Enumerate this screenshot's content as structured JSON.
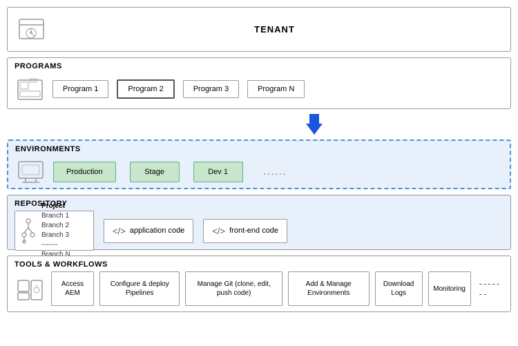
{
  "tenant": {
    "label": "TENANT"
  },
  "programs": {
    "title": "PROGRAMS",
    "items": [
      {
        "label": "Program 1",
        "active": false
      },
      {
        "label": "Program 2",
        "active": true
      },
      {
        "label": "Program 3",
        "active": false
      },
      {
        "label": "Program N",
        "active": false
      }
    ]
  },
  "environments": {
    "title": "ENVIRONMENTS",
    "items": [
      {
        "label": "Production"
      },
      {
        "label": "Stage"
      },
      {
        "label": "Dev 1"
      }
    ],
    "dots": "......"
  },
  "repository": {
    "title": "REPOSITORY",
    "project": {
      "title": "Project",
      "branches": [
        "Branch 1",
        "Branch 2",
        "Branch 3",
        "-------",
        "Branch N"
      ]
    },
    "code_boxes": [
      {
        "label": "application code"
      },
      {
        "label": "front-end code"
      }
    ]
  },
  "tools": {
    "title": "TOOLS & WORKFLOWS",
    "items": [
      {
        "label": "Access AEM"
      },
      {
        "label": "Configure & deploy Pipelines"
      },
      {
        "label": "Manage Git (clone, edit, push code)"
      },
      {
        "label": "Add  & Manage Environments"
      },
      {
        "label": "Download Logs"
      },
      {
        "label": "Monitoring"
      }
    ],
    "dots": "-------"
  }
}
